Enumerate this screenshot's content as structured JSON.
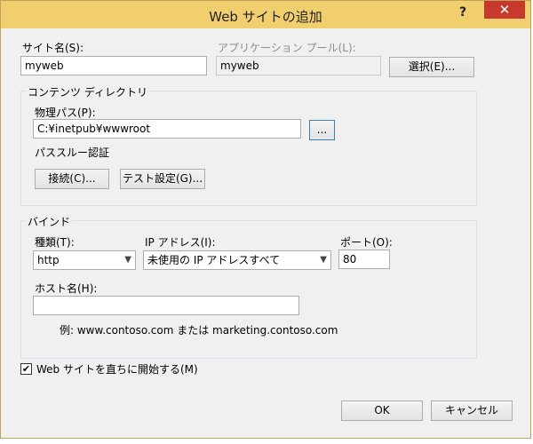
{
  "window": {
    "title": "Web サイトの追加",
    "help": "?",
    "close": "✕"
  },
  "site": {
    "name_label": "サイト名(S):",
    "name_value": "myweb",
    "pool_label": "アプリケーション プール(L):",
    "pool_value": "myweb",
    "select_button": "選択(E)..."
  },
  "content_dir": {
    "group_title": "コンテンツ ディレクトリ",
    "physical_path_label": "物理パス(P):",
    "physical_path_value": "C:¥inetpub¥wwwroot",
    "browse_button": "...",
    "passthrough_label": "パススルー認証",
    "connect_button": "接続(C)...",
    "test_button": "テスト設定(G)..."
  },
  "binding": {
    "group_title": "バインド",
    "type_label": "種類(T):",
    "type_value": "http",
    "ip_label": "IP アドレス(I):",
    "ip_value": "未使用の IP アドレスすべて",
    "port_label": "ポート(O):",
    "port_value": "80",
    "host_label": "ホスト名(H):",
    "host_value": "",
    "example_text": "例: www.contoso.com または marketing.contoso.com"
  },
  "start_now": {
    "label": "Web サイトを直ちに開始する(M)",
    "checked": true
  },
  "footer": {
    "ok_button": "OK",
    "cancel_button": "キャンセル"
  }
}
